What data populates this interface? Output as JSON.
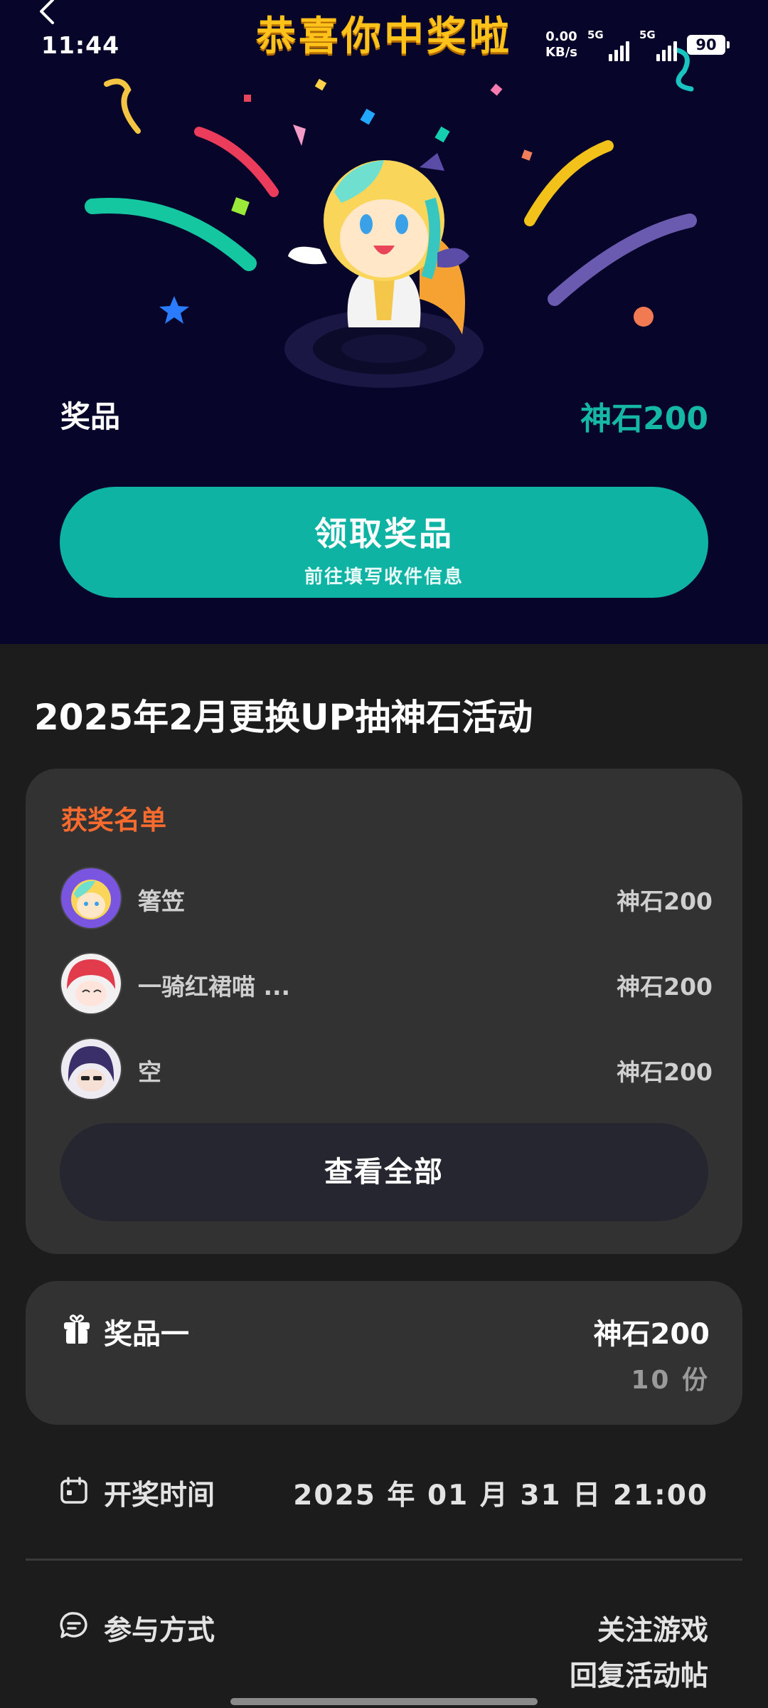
{
  "status_bar": {
    "time": "11:44",
    "net_speed_value": "0.00",
    "net_speed_unit": "KB/s",
    "signal1_label": "5G",
    "signal2_label": "5G",
    "battery": "90"
  },
  "hero": {
    "title": "恭喜你中奖啦",
    "prize_label": "奖品",
    "prize_value": "神石200",
    "claim_button": {
      "label": "领取奖品",
      "sublabel": "前往填写收件信息"
    }
  },
  "activity": {
    "title": "2025年2月更换UP抽神石活动"
  },
  "winners": {
    "heading": "获奖名单",
    "items": [
      {
        "name": "箸笠",
        "prize": "神石200"
      },
      {
        "name": "一骑红裙喵 ...",
        "prize": "神石200"
      },
      {
        "name": "空",
        "prize": "神石200"
      }
    ],
    "view_all_label": "查看全部"
  },
  "prize_info": {
    "name": "奖品一",
    "amount": "神石200",
    "count": "10 份"
  },
  "draw_time": {
    "label": "开奖时间",
    "value": "2025 年 01 月 31 日 21:00"
  },
  "participation": {
    "label": "参与方式",
    "methods": [
      "关注游戏",
      "回复活动帖"
    ]
  },
  "colors": {
    "hero_background": "#07062a",
    "accent_teal": "#0fb3a4",
    "title_yellow": "#ffc21a",
    "winners_orange": "#f86a2e",
    "card_background": "#323232",
    "page_background": "#1c1c1c"
  }
}
